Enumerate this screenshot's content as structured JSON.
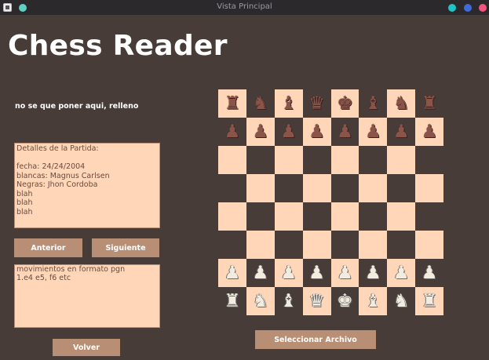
{
  "window": {
    "title": "Vista Principal"
  },
  "header": {
    "app_title": "Chess Reader"
  },
  "filler_text": "no se que poner aqui, relleno",
  "game_details": {
    "lines": [
      "Detalles de la Partida:",
      "",
      "fecha: 24/24/2004",
      "blancas: Magnus Carlsen",
      "Negras: Jhon Cordoba",
      "blah",
      "blah",
      "blah"
    ]
  },
  "navigation": {
    "prev_label": "Anterior",
    "next_label": "Siguiente"
  },
  "moves": {
    "lines": [
      "movimientos en formato pgn",
      "1.e4 e5, f6 etc"
    ]
  },
  "buttons": {
    "back_label": "Volver",
    "select_file_label": "Seleccionar Archivo"
  },
  "board": {
    "ranks": [
      [
        "r",
        "n",
        "b",
        "q",
        "k",
        "b",
        "n",
        "r"
      ],
      [
        "p",
        "p",
        "p",
        "p",
        "p",
        "p",
        "p",
        "p"
      ],
      [
        "",
        "",
        "",
        "",
        "",
        "",
        "",
        ""
      ],
      [
        "",
        "",
        "",
        "",
        "",
        "",
        "",
        ""
      ],
      [
        "",
        "",
        "",
        "",
        "",
        "",
        "",
        ""
      ],
      [
        "",
        "",
        "",
        "",
        "",
        "",
        "",
        ""
      ],
      [
        "P",
        "P",
        "P",
        "P",
        "P",
        "P",
        "P",
        "P"
      ],
      [
        "R",
        "N",
        "B",
        "Q",
        "K",
        "B",
        "N",
        "R"
      ]
    ],
    "light_color": "#ffd7b8",
    "dark_color": "#473c38"
  },
  "colors": {
    "background": "#473c38",
    "panel": "#ffd7b8",
    "button": "#b88e74",
    "title_text": "#ffffff"
  }
}
